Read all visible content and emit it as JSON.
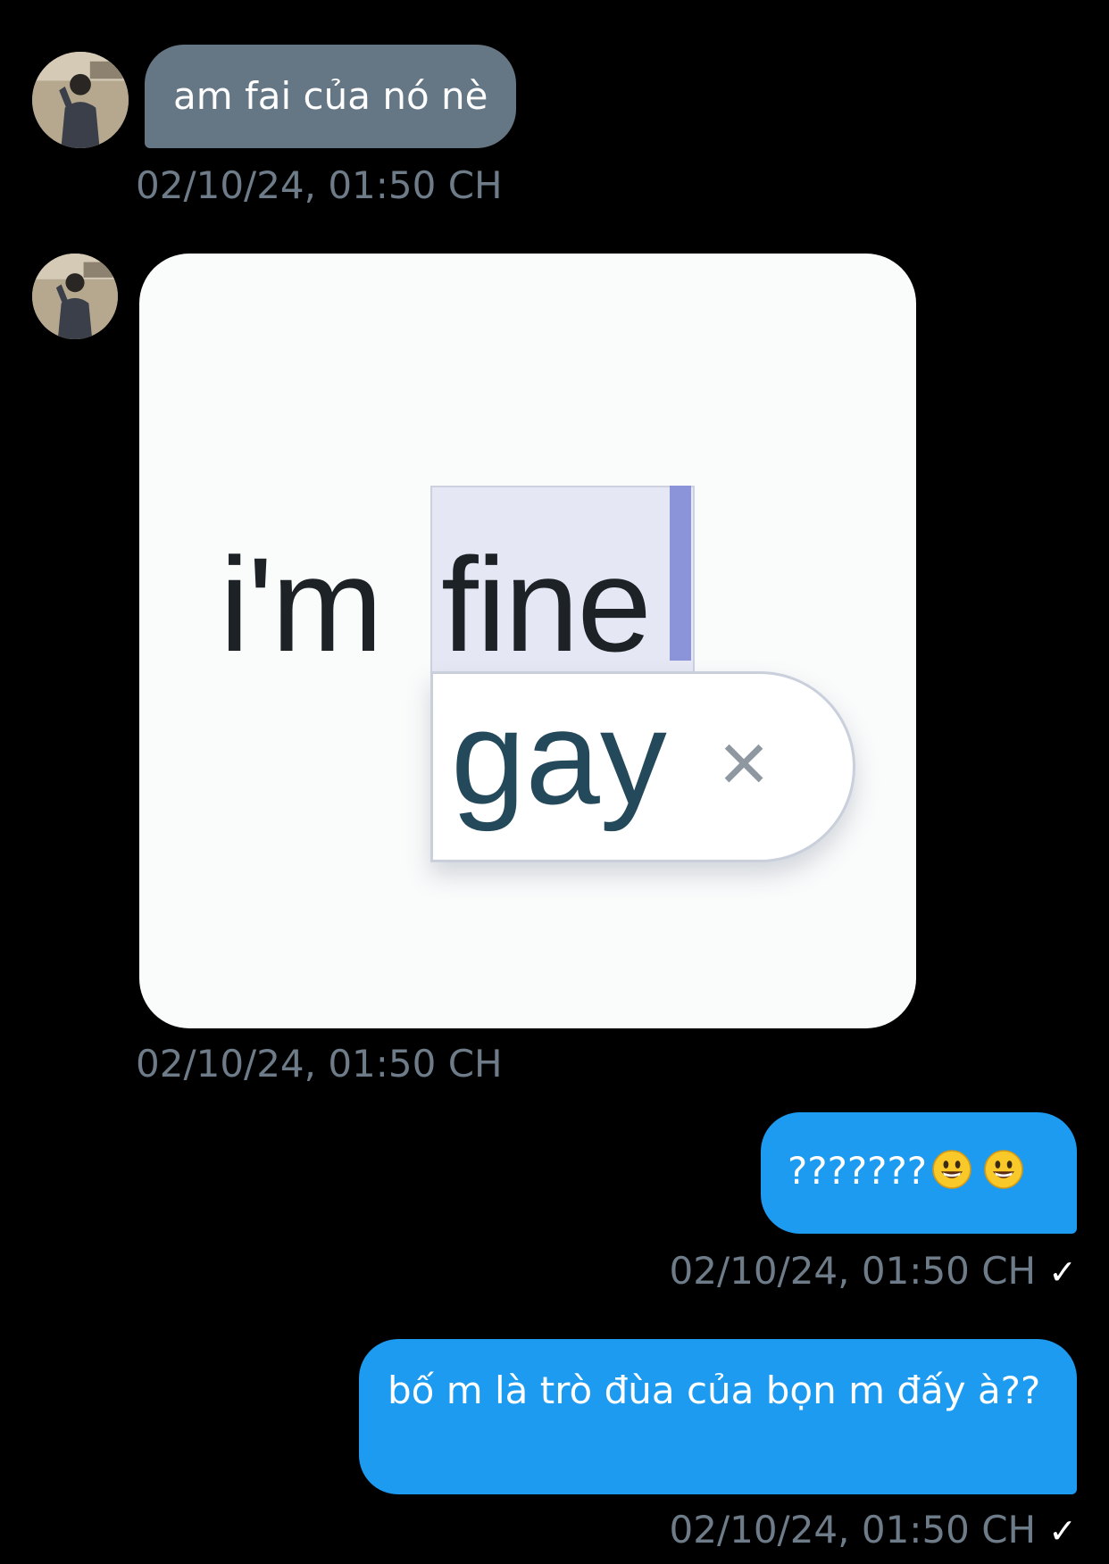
{
  "messages": [
    {
      "direction": "incoming",
      "text": "am fai của nó nè",
      "timestamp": "02/10/24, 01:50 CH"
    },
    {
      "direction": "incoming",
      "media": {
        "line1_plain": "i'm",
        "line1_selected": "fine",
        "suggestion": "gay",
        "dismiss": "×"
      },
      "timestamp": "02/10/24, 01:50 CH"
    },
    {
      "direction": "outgoing",
      "text": "???????",
      "emoji": [
        "grinning-face-emoji",
        "grinning-face-emoji"
      ],
      "timestamp": "02/10/24, 01:50 CH",
      "status": "✓"
    },
    {
      "direction": "outgoing",
      "text": "bố m là trò đùa của bọn m đấy à??",
      "timestamp": "02/10/24, 01:50 CH",
      "status": "✓"
    }
  ],
  "colors": {
    "background": "#000000",
    "incoming_bubble": "#657685",
    "outgoing_bubble": "#1d9bf0",
    "timestamp": "#6e7c89"
  }
}
